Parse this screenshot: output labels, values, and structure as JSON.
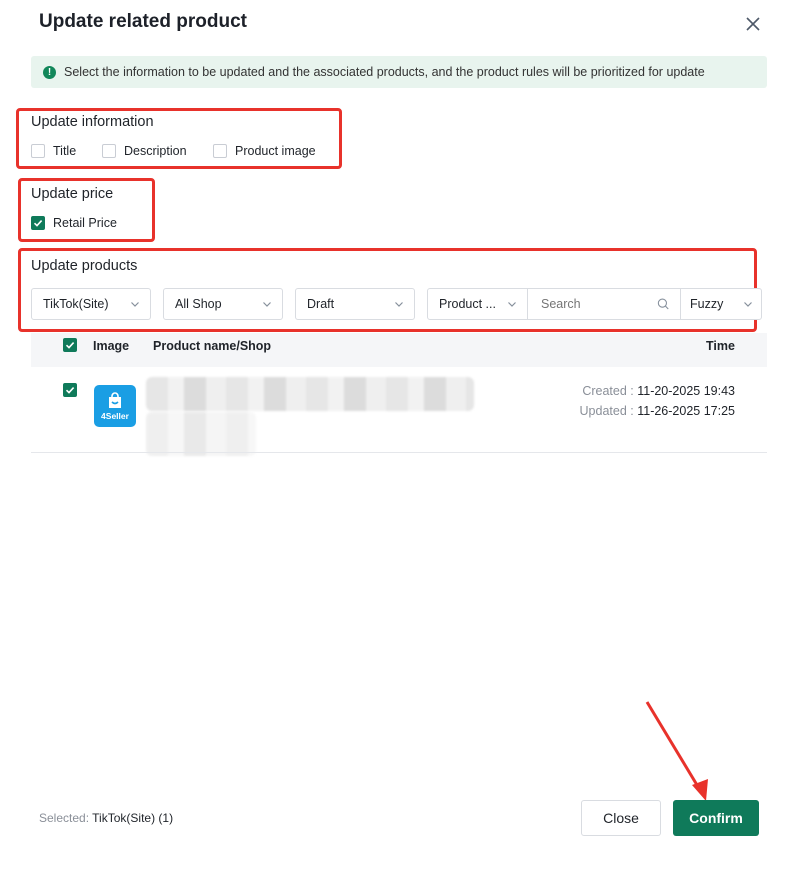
{
  "dialog": {
    "title": "Update related product"
  },
  "alert": {
    "text": "Select the information to be updated and the associated products, and the product rules will be prioritized for update"
  },
  "update_information": {
    "label": "Update information",
    "options": [
      {
        "label": "Title",
        "checked": false
      },
      {
        "label": "Description",
        "checked": false
      },
      {
        "label": "Product image",
        "checked": false
      }
    ]
  },
  "update_price": {
    "label": "Update price",
    "options": [
      {
        "label": "Retail Price",
        "checked": true
      }
    ]
  },
  "update_products": {
    "label": "Update products",
    "filters": {
      "platform": "TikTok(Site)",
      "shop": "All Shop",
      "status": "Draft",
      "field": "Product ...",
      "search_placeholder": "Search",
      "match_mode": "Fuzzy"
    }
  },
  "table": {
    "headers": {
      "image": "Image",
      "name": "Product name/Shop",
      "time": "Time"
    },
    "rows": [
      {
        "checked": true,
        "logo_text": "4Seller",
        "created_label": "Created :",
        "created_value": "11-20-2025 19:43",
        "updated_label": "Updated :",
        "updated_value": "11-26-2025 17:25"
      }
    ]
  },
  "footer": {
    "selected_label": "Selected:",
    "selected_value": "TikTok(Site) (1)",
    "close_label": "Close",
    "confirm_label": "Confirm"
  },
  "colors": {
    "accent": "#0f7a5a",
    "highlight": "#e8322b",
    "alert_bg": "#e8f4ee"
  }
}
